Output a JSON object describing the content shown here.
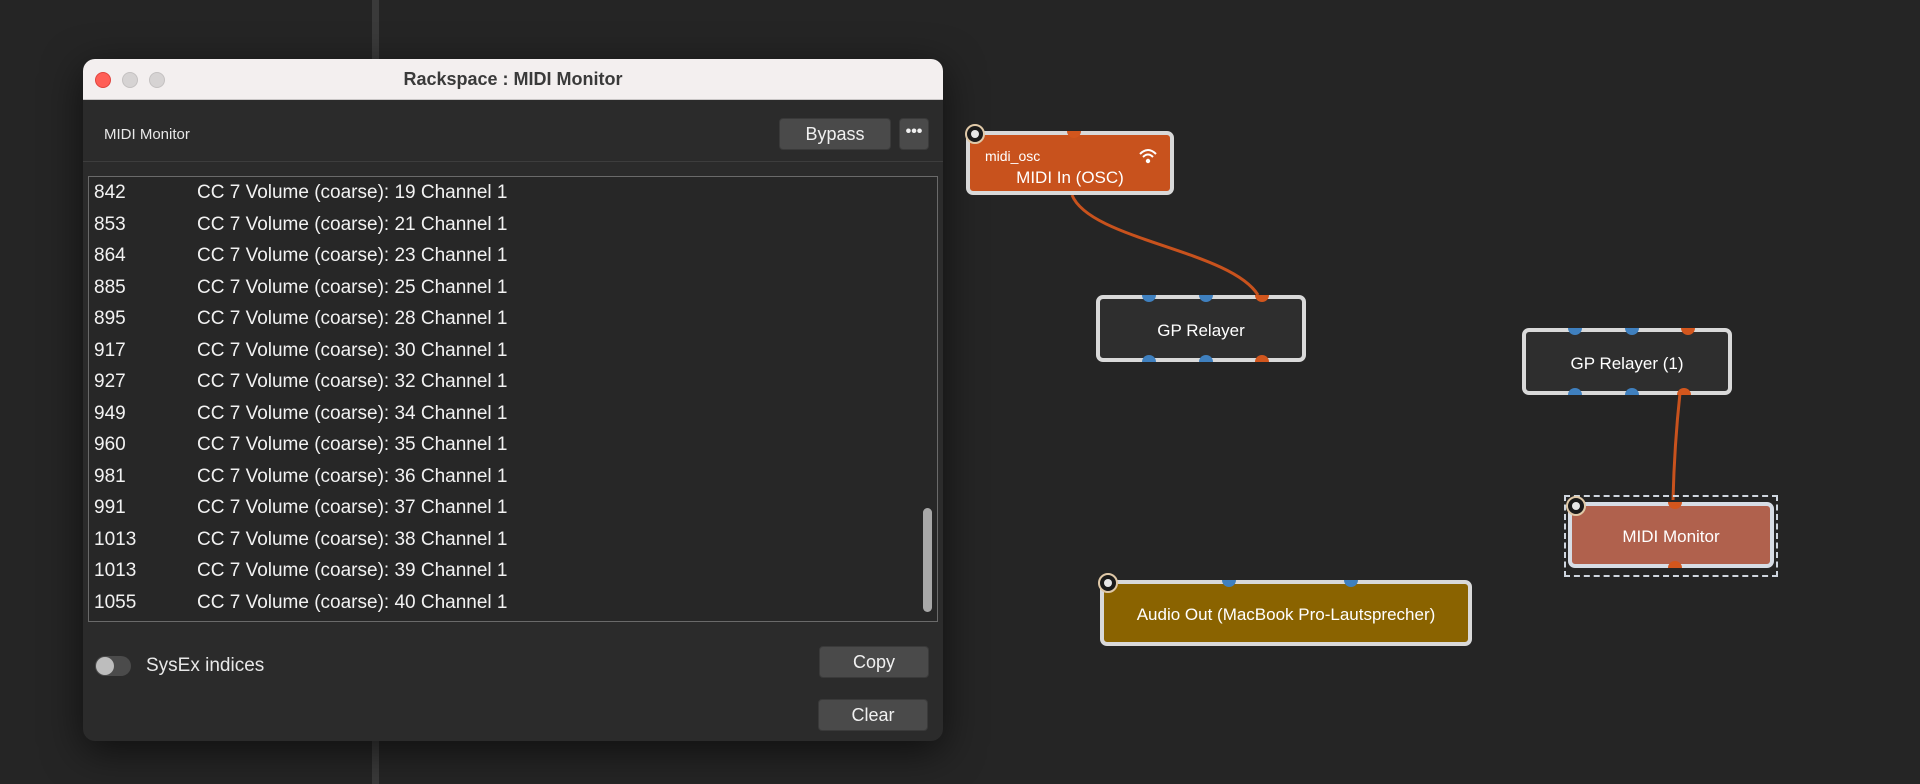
{
  "window": {
    "title": "Rackspace : MIDI Monitor",
    "plugin_name": "MIDI Monitor",
    "bypass_label": "Bypass",
    "more_label": "•••",
    "log": [
      {
        "time": "842",
        "message": "CC 7 Volume (coarse): 19 Channel 1"
      },
      {
        "time": "853",
        "message": "CC 7 Volume (coarse): 21 Channel 1"
      },
      {
        "time": "864",
        "message": "CC 7 Volume (coarse): 23 Channel 1"
      },
      {
        "time": "885",
        "message": "CC 7 Volume (coarse): 25 Channel 1"
      },
      {
        "time": "895",
        "message": "CC 7 Volume (coarse): 28 Channel 1"
      },
      {
        "time": "917",
        "message": "CC 7 Volume (coarse): 30 Channel 1"
      },
      {
        "time": "927",
        "message": "CC 7 Volume (coarse): 32 Channel 1"
      },
      {
        "time": "949",
        "message": "CC 7 Volume (coarse): 34 Channel 1"
      },
      {
        "time": "960",
        "message": "CC 7 Volume (coarse): 35 Channel 1"
      },
      {
        "time": "981",
        "message": "CC 7 Volume (coarse): 36 Channel 1"
      },
      {
        "time": "991",
        "message": "CC 7 Volume (coarse): 37 Channel 1"
      },
      {
        "time": "1013",
        "message": "CC 7 Volume (coarse): 38 Channel 1"
      },
      {
        "time": "1013",
        "message": "CC 7 Volume (coarse): 39 Channel 1"
      },
      {
        "time": "1055",
        "message": "CC 7 Volume (coarse): 40 Channel 1"
      }
    ],
    "sysex_label": "SysEx indices",
    "sysex_enabled": false,
    "copy_label": "Copy",
    "clear_label": "Clear"
  },
  "nodes": {
    "midi_in": {
      "subtitle": "midi_osc",
      "label": "MIDI In (OSC)",
      "color": "#c8521d"
    },
    "gp_relayer": {
      "label": "GP Relayer",
      "color": "#2e2e2e"
    },
    "gp_relayer_1": {
      "label": "GP Relayer (1)",
      "color": "#2e2e2e"
    },
    "midi_monitor": {
      "label": "MIDI Monitor",
      "color": "#b0614d"
    },
    "audio_out": {
      "label": "Audio Out (MacBook Pro-Lautsprecher)",
      "color": "#8a6300"
    }
  },
  "colors": {
    "background": "#252525",
    "wire": "#c8521d",
    "audio_pin": "#3f80bf",
    "midi_pin": "#d2561d"
  }
}
